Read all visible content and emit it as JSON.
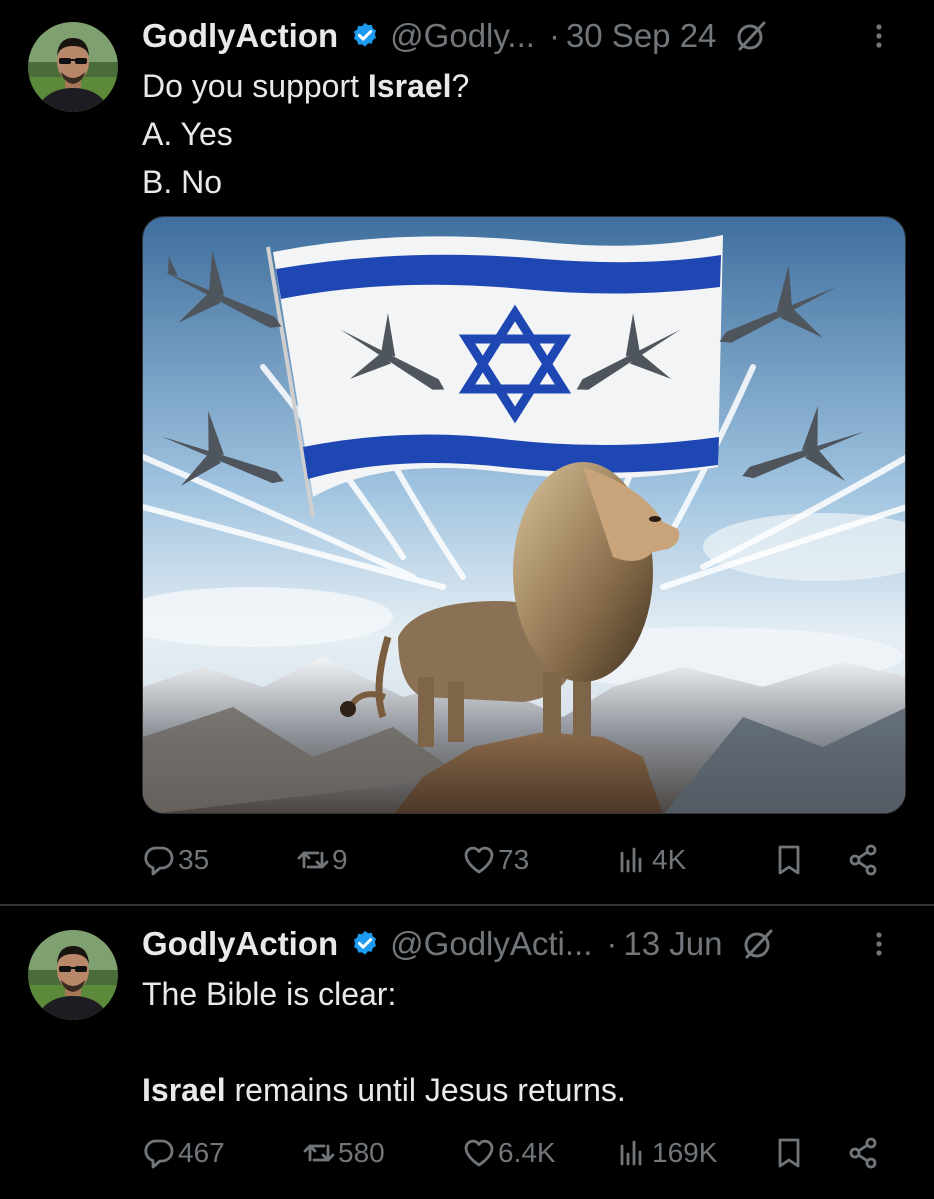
{
  "tweets": [
    {
      "author": "GodlyAction",
      "handle": "@Godly...",
      "dot": "·",
      "date": "30 Sep 24",
      "text": {
        "line1_pre": "Do you support ",
        "line1_bold": "Israel",
        "line1_post": "?",
        "line2": "A. Yes",
        "line3": "B. No"
      },
      "stats": {
        "replies": "35",
        "reposts": "9",
        "likes": "73",
        "views": "4K"
      }
    },
    {
      "author": "GodlyAction",
      "handle": "@GodlyActi...",
      "dot": "·",
      "date": "13 Jun",
      "text": {
        "line1": "The Bible is clear:",
        "line3_bold": "Israel",
        "line3_post": " remains until Jesus returns."
      },
      "stats": {
        "replies": "467",
        "reposts": "580",
        "likes": "6.4K",
        "views": "169K"
      }
    }
  ],
  "icons": {
    "verified": "verified-badge-icon",
    "grok": "grok-icon",
    "more": "more-icon",
    "reply": "reply-icon",
    "repost": "repost-icon",
    "like": "like-icon",
    "views": "views-icon",
    "bookmark": "bookmark-icon",
    "share": "share-icon"
  },
  "colors": {
    "background": "#000000",
    "text": "#e7e9ea",
    "muted": "#71767b",
    "verified": "#1d9bf0",
    "flag_blue": "#1f47b3"
  }
}
